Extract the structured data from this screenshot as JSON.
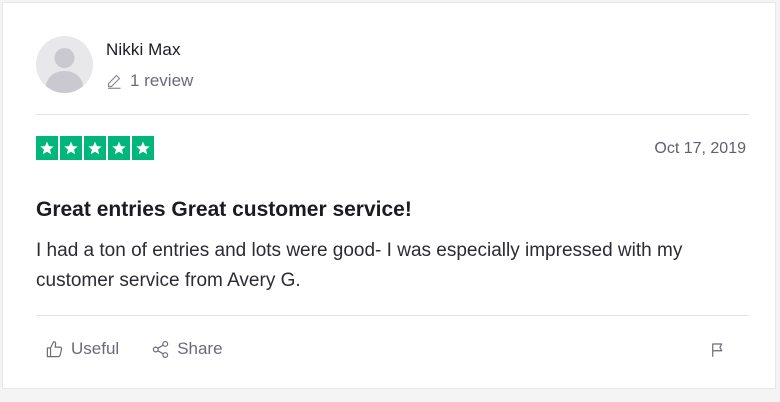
{
  "review": {
    "user_name": "Nikki Max",
    "review_count": "1 review",
    "rating": 5,
    "date": "Oct 17, 2019",
    "title": "Great entries Great customer service!",
    "body": "I had a ton of entries and lots were good- I was especially impressed with my customer service from Avery G."
  },
  "actions": {
    "useful_label": "Useful",
    "share_label": "Share"
  },
  "colors": {
    "star_green": "#00b67a",
    "text_dark": "#1b1b21",
    "text_muted": "#6a6a78"
  },
  "icons": [
    "avatar-placeholder",
    "pencil-icon",
    "star-icon",
    "thumbs-up-icon",
    "share-icon",
    "flag-icon"
  ]
}
